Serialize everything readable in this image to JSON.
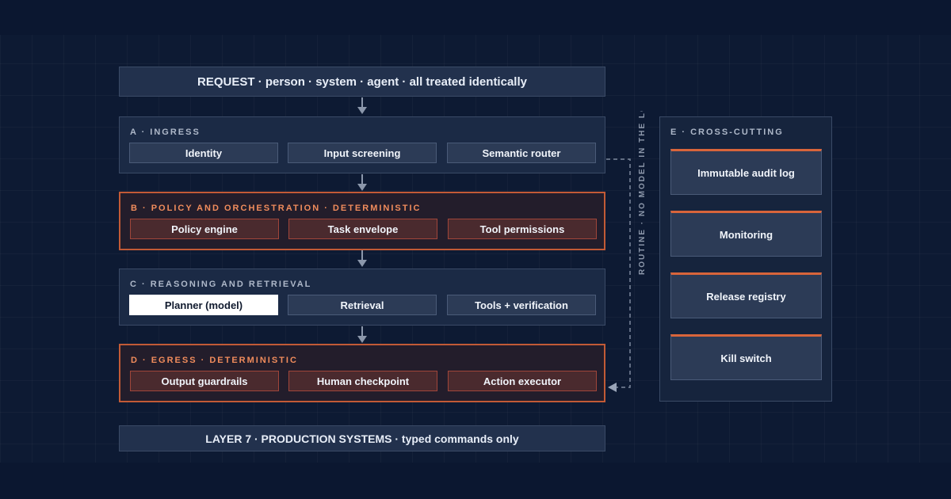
{
  "request": "REQUEST · person · system · agent · all treated identically",
  "layers": {
    "a": {
      "title": "A · INGRESS",
      "cells": [
        "Identity",
        "Input screening",
        "Semantic router"
      ]
    },
    "b": {
      "title": "B · POLICY AND ORCHESTRATION · DETERMINISTIC",
      "cells": [
        "Policy engine",
        "Task envelope",
        "Tool permissions"
      ]
    },
    "c": {
      "title": "C · REASONING AND RETRIEVAL",
      "cells": [
        "Planner (model)",
        "Retrieval",
        "Tools + verification"
      ]
    },
    "d": {
      "title": "D · EGRESS · DETERMINISTIC",
      "cells": [
        "Output guardrails",
        "Human checkpoint",
        "Action executor"
      ]
    }
  },
  "layer7": "LAYER 7 · PRODUCTION SYSTEMS · typed commands only",
  "routine_label": "ROUTINE · NO MODEL IN THE LOOP",
  "cross_cutting": {
    "title": "E · CROSS-CUTTING",
    "items": [
      "Immutable audit log",
      "Monitoring",
      "Release registry",
      "Kill switch"
    ]
  },
  "colors": {
    "background": "#0d1a33",
    "accent": "#d9653b",
    "deterministic_text": "#f08c5c",
    "highlight": "#ffffff"
  }
}
